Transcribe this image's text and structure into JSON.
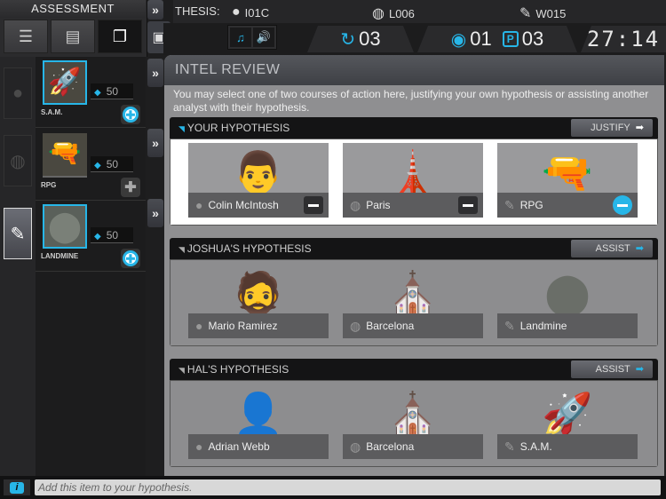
{
  "assessment": {
    "title": "ASSESSMENT",
    "tabs": [
      {
        "icon": "checklist-icon",
        "glyph": "☰"
      },
      {
        "icon": "document-icon",
        "glyph": "▤"
      },
      {
        "icon": "documents-icon",
        "glyph": "❐"
      }
    ]
  },
  "categories": [
    {
      "name": "suspect",
      "glyph": "●"
    },
    {
      "name": "location",
      "glyph": "◍"
    },
    {
      "name": "weapon",
      "glyph": "✎"
    }
  ],
  "items": [
    {
      "name": "S.A.M.",
      "cost": "50",
      "glyph": "🚀",
      "selected": true
    },
    {
      "name": "RPG",
      "cost": "50",
      "glyph": "🔫",
      "selected": false
    },
    {
      "name": "LANDMINE",
      "cost": "50",
      "glyph": "⬤",
      "selected": true
    }
  ],
  "header": {
    "thesis_label": "THESIS:",
    "suspect_code": "I01C",
    "location_code": "L006",
    "weapon_code": "W015",
    "music_icon": "♫",
    "sound_icon": "🔊",
    "turns": "03",
    "merits": "01",
    "points": "03",
    "points_badge": "P",
    "timer": "27:14"
  },
  "main": {
    "title": "INTEL REVIEW",
    "description": "You may select one of two courses of action here, justifying your own hypothesis or assisting another analyst with their hypothesis."
  },
  "hypotheses": [
    {
      "title": "YOUR HYPOTHESIS",
      "action": "JUSTIFY",
      "suspect": "Colin McIntosh",
      "location": "Paris",
      "weapon": "RPG",
      "suspect_glyph": "👨",
      "location_glyph": "🗼",
      "weapon_glyph": "🔫"
    },
    {
      "title": "JOSHUA'S HYPOTHESIS",
      "action": "ASSIST",
      "suspect": "Mario Ramirez",
      "location": "Barcelona",
      "weapon": "Landmine",
      "suspect_glyph": "🧔",
      "location_glyph": "⛪",
      "weapon_glyph": "⬤"
    },
    {
      "title": "HAL'S HYPOTHESIS",
      "action": "ASSIST",
      "suspect": "Adrian Webb",
      "location": "Barcelona",
      "weapon": "S.A.M.",
      "suspect_glyph": "👤",
      "location_glyph": "⛪",
      "weapon_glyph": "🚀"
    }
  ],
  "status": {
    "info_label": "i",
    "hint": "Add this item to your hypothesis."
  },
  "colors": {
    "accent": "#27b6e8",
    "panel": "#8f8f91",
    "dark": "#1c1c1d"
  }
}
